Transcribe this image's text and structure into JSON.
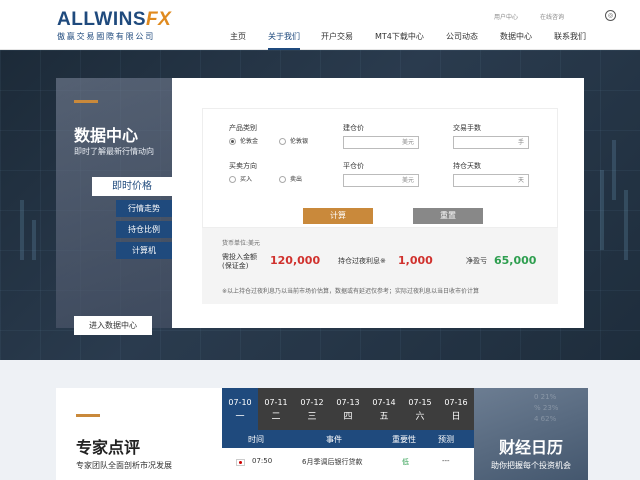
{
  "brand": {
    "name_main": "ALLWINS",
    "name_fx": "FX",
    "subtitle": "傲赢交易國際有限公司"
  },
  "toplinks": [
    "用户中心",
    "在线咨询"
  ],
  "nav": [
    "主页",
    "关于我们",
    "开户交易",
    "MT4下载中心",
    "公司动态",
    "数据中心",
    "联系我们"
  ],
  "nav_active": "关于我们",
  "hero": {
    "title": "数据中心",
    "subtitle": "即时了解最新行情动向",
    "menu_main": "即时价格",
    "menu_sub": [
      "行情走势",
      "持仓比例",
      "计算机"
    ],
    "enter_button": "进入数据中心"
  },
  "calculator": {
    "product_label": "产品类别",
    "product_options": [
      "伦敦金",
      "伦敦银"
    ],
    "product_selected": "伦敦金",
    "open_price_label": "建仓价",
    "open_price_unit": "美元",
    "lots_label": "交易手数",
    "lots_unit": "手",
    "direction_label": "买卖方向",
    "direction_options": [
      "买入",
      "卖出"
    ],
    "close_price_label": "平仓价",
    "close_price_unit": "美元",
    "days_label": "持仓天数",
    "days_unit": "天",
    "calc_button": "计算",
    "reset_button": "重置",
    "currency_unit": "货币单位:美元",
    "margin_label": "需投入金额\n(保证金)",
    "margin_label_1": "需投入金额",
    "margin_label_2": "(保证金)",
    "margin_value": "120,000",
    "interest_label": "持仓过夜利息※",
    "interest_value": "1,000",
    "pnl_label": "净盈亏",
    "pnl_value": "65,000",
    "note": "※以上持仓过夜利息乃以当前市场价估算，数据或有延迟仅参考；实际过夜利息以当日收市价计算"
  },
  "colors": {
    "brand_blue": "#1f4a7d",
    "accent_gold": "#c9893b",
    "red": "#d0312d",
    "green": "#2e9e4f"
  },
  "expert": {
    "title": "专家点评",
    "subtitle": "专家团队全面剖析市况发展"
  },
  "calendar_dates": [
    {
      "date": "07-10",
      "weekday": "一"
    },
    {
      "date": "07-11",
      "weekday": "二"
    },
    {
      "date": "07-12",
      "weekday": "三"
    },
    {
      "date": "07-13",
      "weekday": "四"
    },
    {
      "date": "07-14",
      "weekday": "五"
    },
    {
      "date": "07-15",
      "weekday": "六"
    },
    {
      "date": "07-16",
      "weekday": "日"
    }
  ],
  "calendar_active": "07-10",
  "calendar_headers": [
    "时间",
    "事件",
    "重要性",
    "预测"
  ],
  "calendar_rows": [
    {
      "flag": "japan-flag-icon",
      "time": "07:50",
      "event": "6月季调后银行贷款",
      "importance": "低",
      "forecast": "---"
    }
  ],
  "finance_calendar": {
    "title": "财经日历",
    "subtitle": "助你把握每个投资机会"
  }
}
